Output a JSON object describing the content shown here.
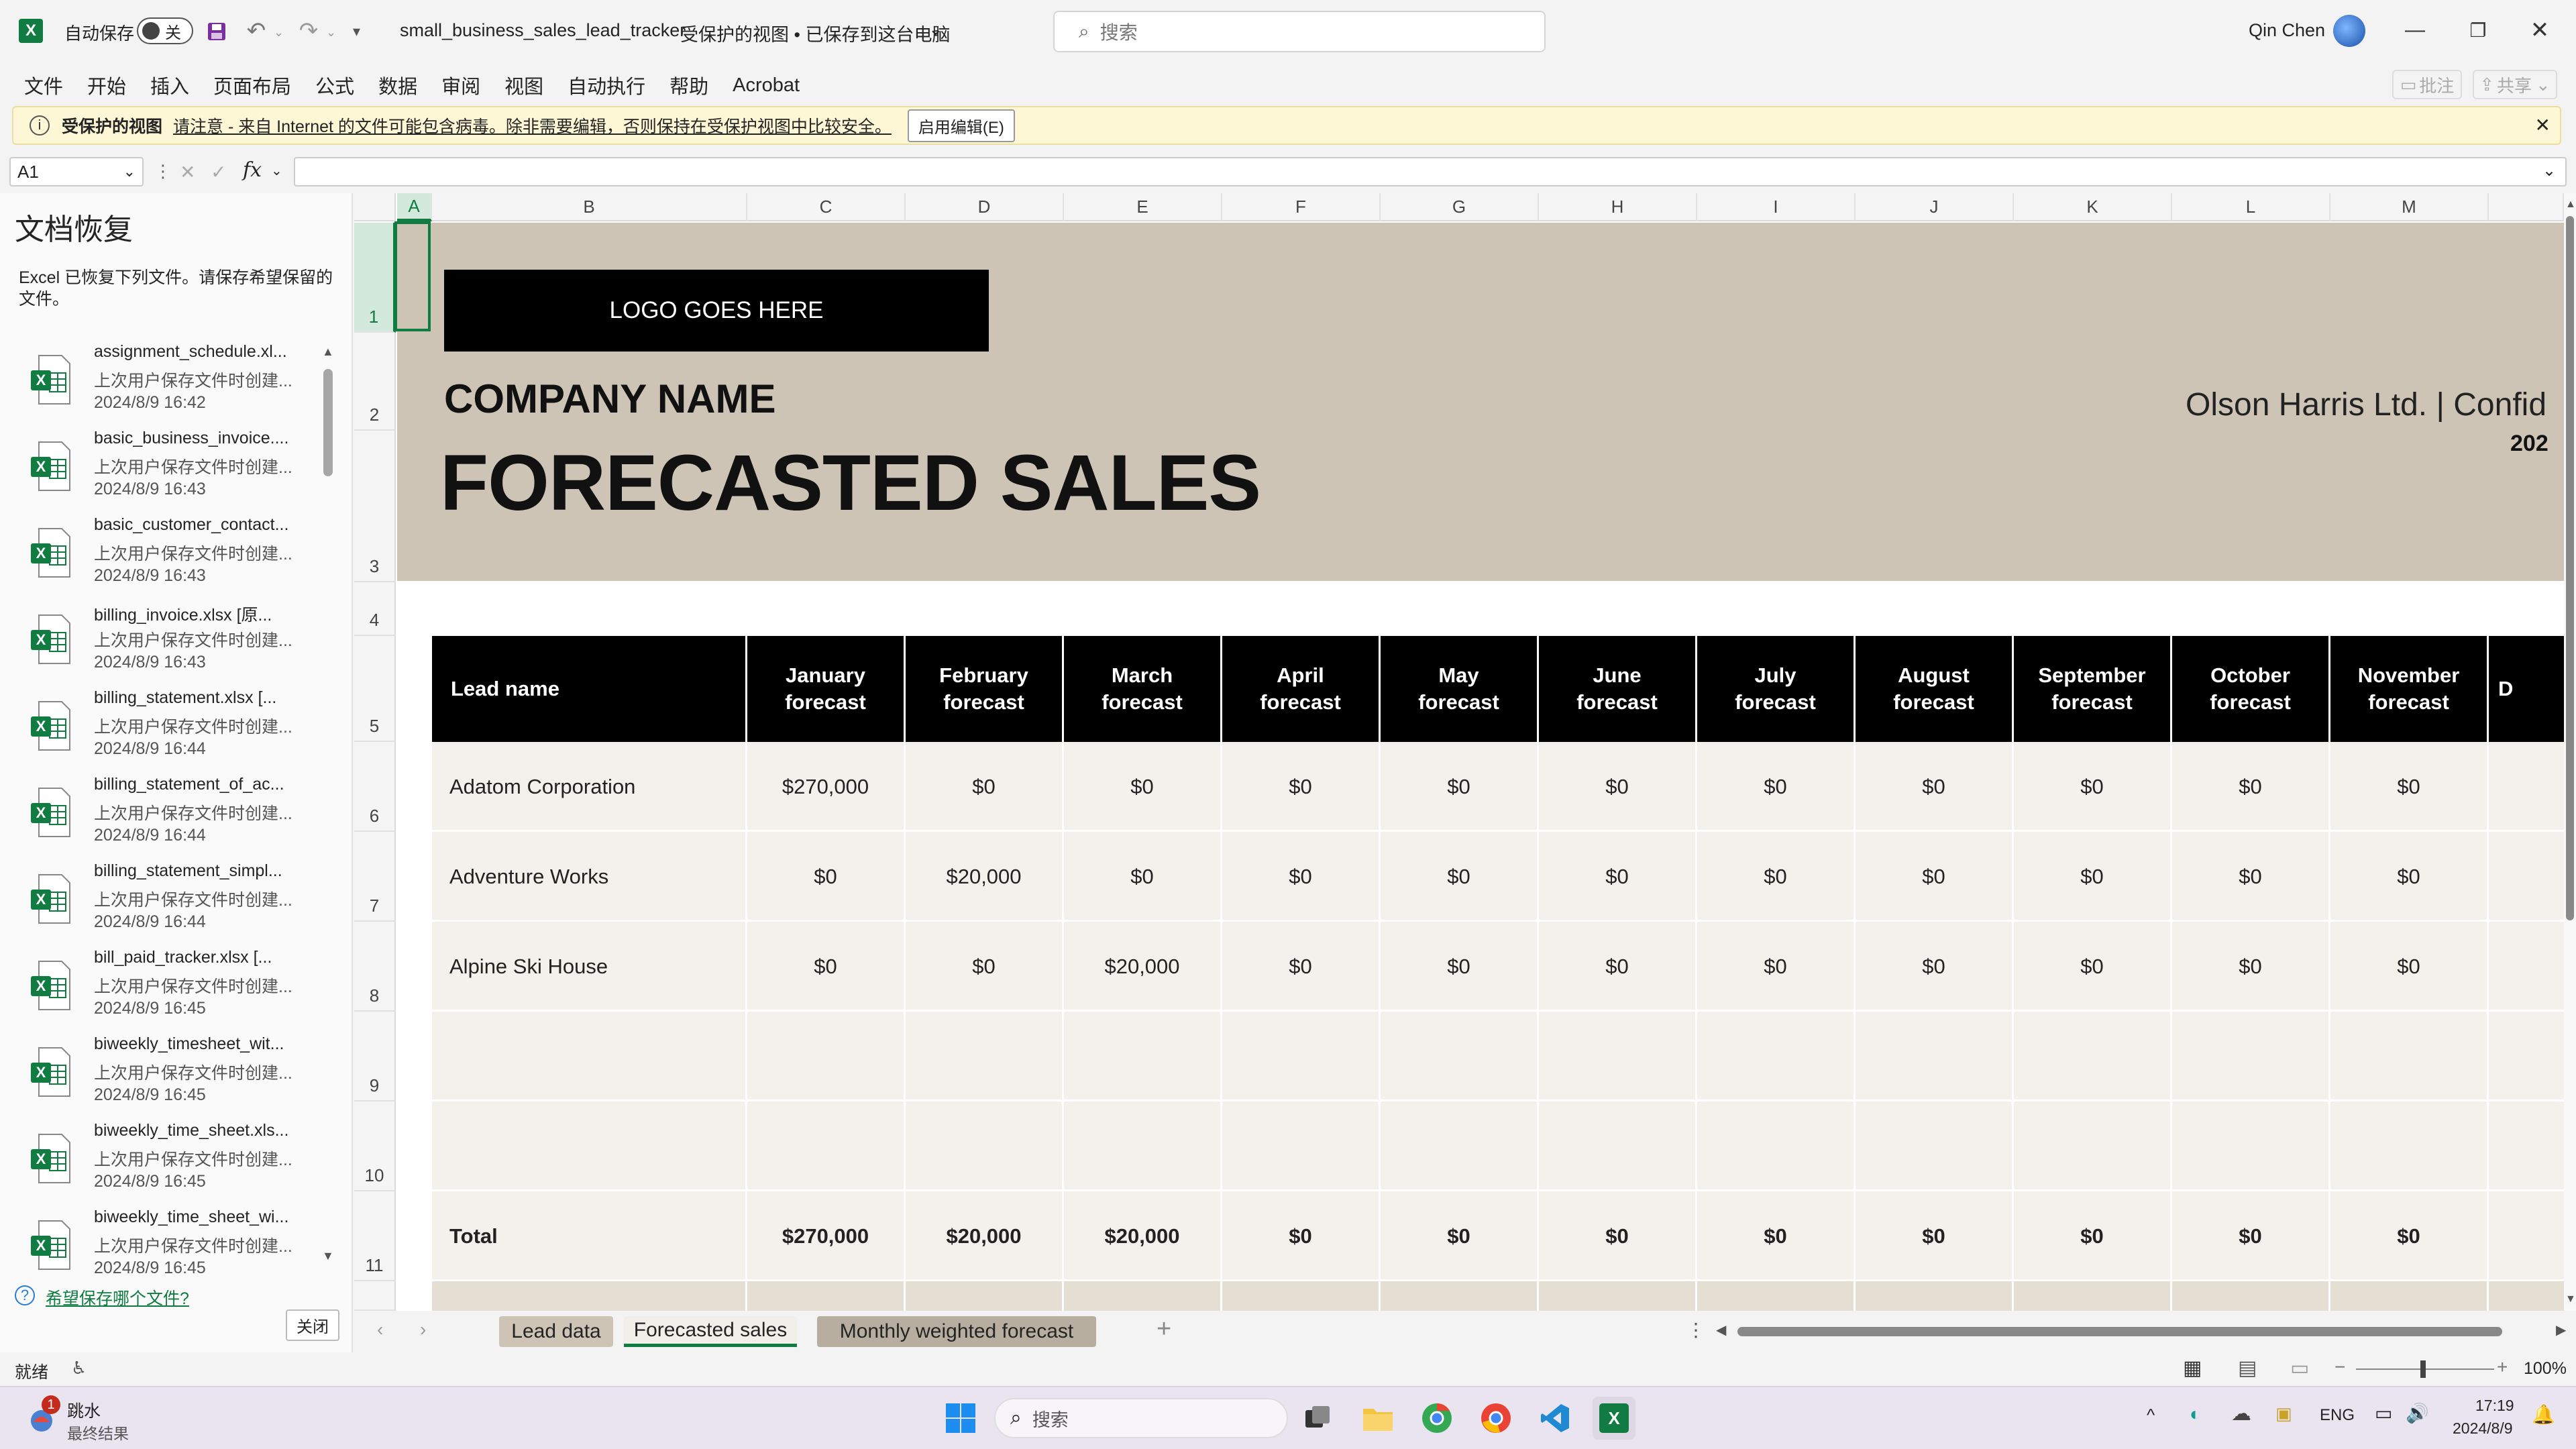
{
  "titlebar": {
    "autosave_label": "自动保存",
    "autosave_state": "关",
    "filename": "small_business_sales_lead_tracker",
    "status": "受保护的视图 • 已保存到这台电脑",
    "search_placeholder": "搜索",
    "user_name": "Qin Chen"
  },
  "menu": [
    "文件",
    "开始",
    "插入",
    "页面布局",
    "公式",
    "数据",
    "审阅",
    "视图",
    "自动执行",
    "帮助",
    "Acrobat"
  ],
  "ribbon_right": {
    "comments": "批注",
    "share": "共享"
  },
  "msgbar": {
    "title": "受保护的视图",
    "text": "请注意 - 来自 Internet 的文件可能包含病毒。除非需要编辑，否则保持在受保护视图中比较安全。",
    "button": "启用编辑(E)"
  },
  "formula": {
    "namebox": "A1",
    "fx": "fx",
    "value": ""
  },
  "recovery": {
    "title": "文档恢复",
    "desc": "Excel 已恢复下列文件。请保存希望保留的文件。",
    "items": [
      {
        "name": "assignment_schedule.xl...",
        "sub": "上次用户保存文件时创建...",
        "time": "2024/8/9 16:42"
      },
      {
        "name": "basic_business_invoice....",
        "sub": "上次用户保存文件时创建...",
        "time": "2024/8/9 16:43"
      },
      {
        "name": "basic_customer_contact...",
        "sub": "上次用户保存文件时创建...",
        "time": "2024/8/9 16:43"
      },
      {
        "name": "billing_invoice.xlsx [原...",
        "sub": "上次用户保存文件时创建...",
        "time": "2024/8/9 16:43"
      },
      {
        "name": "billing_statement.xlsx [...",
        "sub": "上次用户保存文件时创建...",
        "time": "2024/8/9 16:44"
      },
      {
        "name": "billing_statement_of_ac...",
        "sub": "上次用户保存文件时创建...",
        "time": "2024/8/9 16:44"
      },
      {
        "name": "billing_statement_simpl...",
        "sub": "上次用户保存文件时创建...",
        "time": "2024/8/9 16:44"
      },
      {
        "name": "bill_paid_tracker.xlsx [...",
        "sub": "上次用户保存文件时创建...",
        "time": "2024/8/9 16:45"
      },
      {
        "name": "biweekly_timesheet_wit...",
        "sub": "上次用户保存文件时创建...",
        "time": "2024/8/9 16:45"
      },
      {
        "name": "biweekly_time_sheet.xls...",
        "sub": "上次用户保存文件时创建...",
        "time": "2024/8/9 16:45"
      },
      {
        "name": "biweekly_time_sheet_wi...",
        "sub": "上次用户保存文件时创建...",
        "time": "2024/8/9 16:45"
      }
    ],
    "help_link": "希望保存哪个文件?",
    "close_button": "关闭"
  },
  "grid": {
    "columns": [
      "A",
      "B",
      "C",
      "D",
      "E",
      "F",
      "G",
      "H",
      "I",
      "J",
      "K",
      "L",
      "M"
    ],
    "rows": [
      "1",
      "2",
      "3",
      "4",
      "5",
      "6",
      "7",
      "8",
      "9",
      "10",
      "11"
    ],
    "logo": "LOGO GOES HERE",
    "company": "COMPANY NAME",
    "title": "FORECASTED SALES",
    "client": "Olson Harris Ltd.  |  Confid",
    "year": "202",
    "header_lead": "Lead name",
    "months": [
      "January\nforecast",
      "February\nforecast",
      "March\nforecast",
      "April\nforecast",
      "May\nforecast",
      "June\nforecast",
      "July\nforecast",
      "August\nforecast",
      "September\nforecast",
      "October\nforecast",
      "November\nforecast"
    ],
    "header_cut": "D",
    "leads": [
      {
        "name": "Adatom Corporation",
        "values": [
          "$270,000",
          "$0",
          "$0",
          "$0",
          "$0",
          "$0",
          "$0",
          "$0",
          "$0",
          "$0",
          "$0"
        ]
      },
      {
        "name": "Adventure Works",
        "values": [
          "$0",
          "$20,000",
          "$0",
          "$0",
          "$0",
          "$0",
          "$0",
          "$0",
          "$0",
          "$0",
          "$0"
        ]
      },
      {
        "name": "Alpine Ski House",
        "values": [
          "$0",
          "$0",
          "$20,000",
          "$0",
          "$0",
          "$0",
          "$0",
          "$0",
          "$0",
          "$0",
          "$0"
        ]
      }
    ],
    "total_label": "Total",
    "totals": [
      "$270,000",
      "$20,000",
      "$20,000",
      "$0",
      "$0",
      "$0",
      "$0",
      "$0",
      "$0",
      "$0",
      "$0"
    ]
  },
  "sheets": {
    "tabs": [
      "Lead data",
      "Forecasted sales",
      "Monthly weighted forecast"
    ],
    "active": "Forecasted sales"
  },
  "status": {
    "ready": "就绪",
    "zoom": "100%"
  },
  "taskbar": {
    "weather_title": "跳水",
    "weather_sub": "最终结果",
    "badge": "1",
    "search": "搜索",
    "lang": "ENG",
    "time": "17:19",
    "date": "2024/8/9"
  },
  "colors": {
    "banner": "#cdc4b6",
    "header": "#000000",
    "row_bg": "#f3f1ec",
    "excel_green": "#107c41"
  }
}
